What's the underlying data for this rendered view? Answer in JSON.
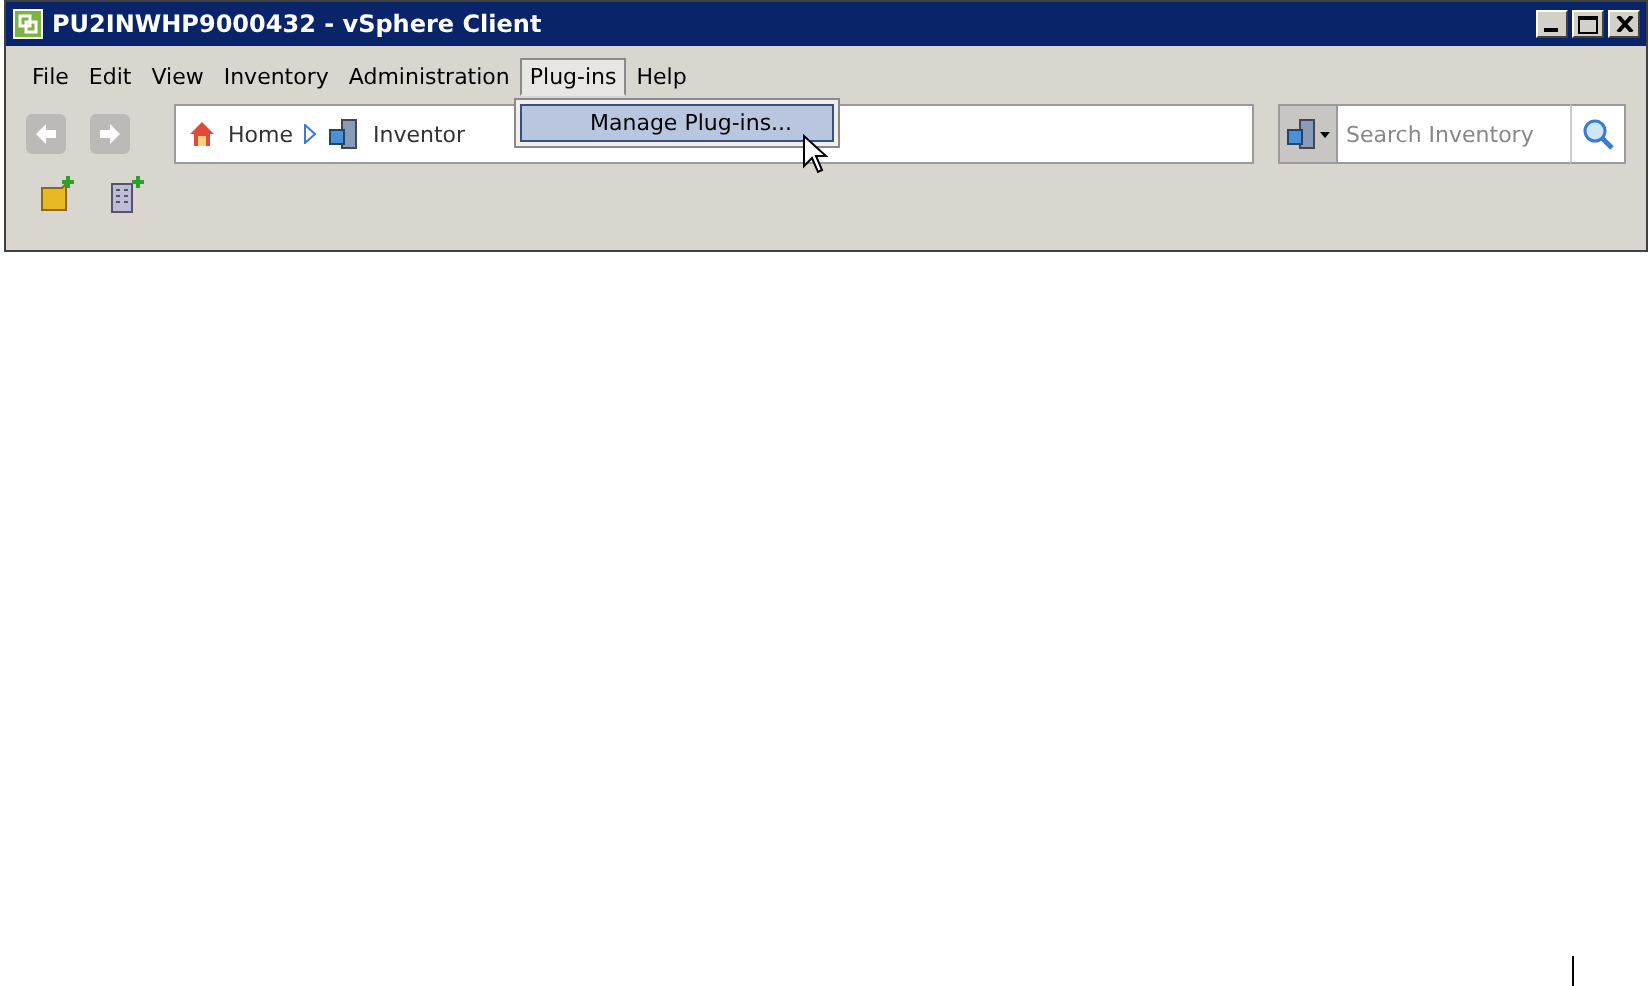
{
  "window": {
    "title": "PU2INWHP9000432 - vSphere Client"
  },
  "menu": [
    {
      "label": "File",
      "selected": false
    },
    {
      "label": "Edit",
      "selected": false
    },
    {
      "label": "View",
      "selected": false
    },
    {
      "label": "Inventory",
      "selected": false
    },
    {
      "label": "Administration",
      "selected": false
    },
    {
      "label": "Plug-ins",
      "selected": true
    },
    {
      "label": "Help",
      "selected": false
    }
  ],
  "dropdown": {
    "items": [
      {
        "label": "Manage Plug-ins...",
        "selected": true
      }
    ]
  },
  "navigation": {
    "back_disabled": true,
    "forward_disabled": true
  },
  "breadcrumb": [
    {
      "label": "Home"
    },
    {
      "label": "Inventor"
    }
  ],
  "search": {
    "placeholder": "Search Inventory"
  }
}
